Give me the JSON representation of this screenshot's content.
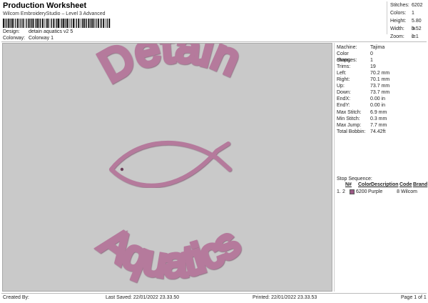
{
  "header": {
    "title": "Production Worksheet",
    "subtitle": "Wilcom EmbroideryStudio – Level 3 Advanced",
    "design_label": "Design:",
    "design_value": "detain aquatics v2 5",
    "colorway_label": "Colorway:",
    "colorway_value": "Colorway 1"
  },
  "summary": {
    "stitches_label": "Stitches:",
    "stitches_value": "6202",
    "colors_label": "Colors:",
    "colors_value": "1",
    "height_label": "Height:",
    "height_value": "5.80 in",
    "width_label": "Width:",
    "width_value": "5.52 in",
    "zoom_label": "Zoom:",
    "zoom_value": "1:1"
  },
  "design": {
    "top_text": "Detain",
    "bottom_text": "Aquatics",
    "thread_color": "#b57a9c",
    "canvas_color": "#c9c9c9"
  },
  "info": {
    "rows": [
      {
        "label": "Machine:",
        "value": "Tajima"
      },
      {
        "label": "Color changes:",
        "value": "0"
      },
      {
        "label": "Stops:",
        "value": "1"
      },
      {
        "label": "Trims:",
        "value": "19"
      },
      {
        "label": "Left:",
        "value": "70.2 mm"
      },
      {
        "label": "Right:",
        "value": "70.1 mm"
      },
      {
        "label": "Up:",
        "value": "73.7 mm"
      },
      {
        "label": "Down:",
        "value": "73.7 mm"
      },
      {
        "label": "EndX:",
        "value": "0.00 in"
      },
      {
        "label": "EndY:",
        "value": "0.00 in"
      },
      {
        "label": "Max Stitch:",
        "value": "6.9 mm"
      },
      {
        "label": "Min Stitch:",
        "value": "0.3 mm"
      },
      {
        "label": "Max Jump:",
        "value": "7.7 mm"
      },
      {
        "label": "Total Bobbin:",
        "value": "74.42ft"
      }
    ],
    "stop_sequence_label": "Stop Sequence:",
    "seq_headers": {
      "n": "N#",
      "color": "Color",
      "desc": "Description",
      "code": "Code",
      "brand": "Brand"
    },
    "seq_row": {
      "index": "1.",
      "n": "2",
      "stitches": "6200",
      "desc": "Purple",
      "code": "8",
      "brand": "Wilcom",
      "swatch": "#9b5a86"
    }
  },
  "footer": {
    "created_by": "Created By:",
    "last_saved": "Last Saved: 22/01/2022 23.33.50",
    "printed": "Printed: 22/01/2022 23.33.53",
    "page": "Page 1 of 1"
  }
}
